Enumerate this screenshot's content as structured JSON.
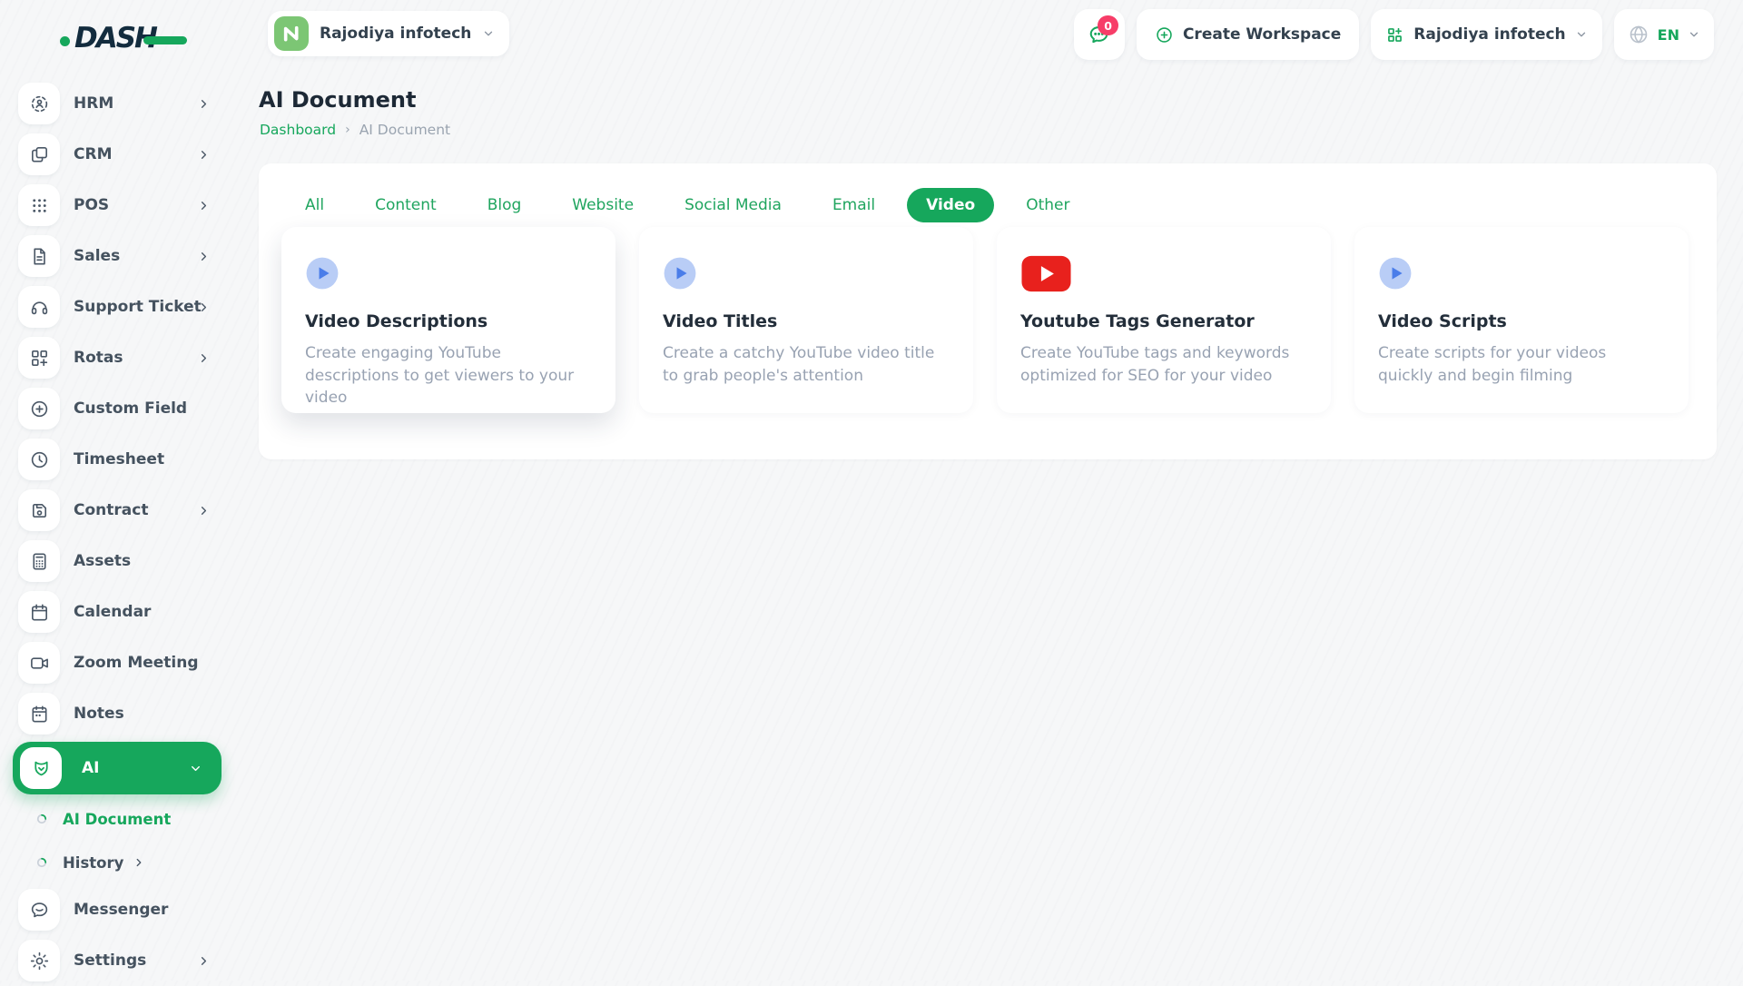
{
  "brand": {
    "logo_text": "DASH"
  },
  "header": {
    "workspace_switcher": {
      "label": "Rajodiya infotech",
      "icon": "workspace-logo-icon"
    },
    "messages_badge": "0",
    "create_workspace_label": "Create Workspace",
    "account_menu_label": "Rajodiya infotech",
    "language": "EN"
  },
  "page": {
    "title": "AI Document",
    "breadcrumb": {
      "items": [
        "Dashboard",
        "AI Document"
      ],
      "separator": "›"
    }
  },
  "sidebar": {
    "items": [
      {
        "label": "HRM",
        "icon": "hrm-icon",
        "type": "main",
        "expandable": true
      },
      {
        "label": "CRM",
        "icon": "crm-icon",
        "type": "main",
        "expandable": true
      },
      {
        "label": "POS",
        "icon": "pos-icon",
        "type": "main",
        "expandable": true
      },
      {
        "label": "Sales",
        "icon": "sales-icon",
        "type": "main",
        "expandable": true
      },
      {
        "label": "Support Ticket",
        "icon": "support-ticket-icon",
        "type": "main",
        "expandable": true
      },
      {
        "label": "Rotas",
        "icon": "rotas-icon",
        "type": "main",
        "expandable": true
      },
      {
        "label": "Custom Field",
        "icon": "custom-field-icon",
        "type": "main",
        "expandable": false
      },
      {
        "label": "Timesheet",
        "icon": "timesheet-icon",
        "type": "main",
        "expandable": false
      },
      {
        "label": "Contract",
        "icon": "contract-icon",
        "type": "main",
        "expandable": true
      },
      {
        "label": "Assets",
        "icon": "assets-icon",
        "type": "main",
        "expandable": false
      },
      {
        "label": "Calendar",
        "icon": "calendar-icon",
        "type": "main",
        "expandable": false
      },
      {
        "label": "Zoom Meeting",
        "icon": "zoom-meeting-icon",
        "type": "main",
        "expandable": false
      },
      {
        "label": "Notes",
        "icon": "notes-icon",
        "type": "main",
        "expandable": false
      },
      {
        "label": "AI",
        "icon": "ai-icon",
        "type": "parent-active",
        "expandable": true,
        "expanded": true
      },
      {
        "label": "AI Document",
        "icon": "progress-dot-icon",
        "type": "sub",
        "active": true
      },
      {
        "label": "History",
        "icon": "progress-dot-icon",
        "type": "sub",
        "expandable": true
      },
      {
        "label": "Messenger",
        "icon": "messenger-icon",
        "type": "main",
        "expandable": false
      },
      {
        "label": "Settings",
        "icon": "settings-icon",
        "type": "main",
        "expandable": true
      }
    ]
  },
  "tabs": {
    "items": [
      {
        "label": "All"
      },
      {
        "label": "Content"
      },
      {
        "label": "Blog"
      },
      {
        "label": "Website"
      },
      {
        "label": "Social Media"
      },
      {
        "label": "Email"
      },
      {
        "label": "Video",
        "active": true
      },
      {
        "label": "Other"
      }
    ]
  },
  "cards": [
    {
      "title": "Video Descriptions",
      "description": "Create engaging YouTube descriptions to get viewers to your video",
      "icon": "play-circle-icon",
      "featured": true
    },
    {
      "title": "Video Titles",
      "description": "Create a catchy YouTube video title to grab people's attention",
      "icon": "play-circle-icon",
      "featured": false
    },
    {
      "title": "Youtube Tags Generator",
      "description": "Create YouTube tags and keywords optimized for SEO for your video",
      "icon": "youtube-icon",
      "featured": false
    },
    {
      "title": "Video Scripts",
      "description": "Create scripts for your videos quickly and begin filming",
      "icon": "play-circle-icon",
      "featured": false
    }
  ],
  "colors": {
    "accent_green": "#16a75c",
    "badge_pink": "#f73d68",
    "youtube_red": "#e8211d",
    "play_blue": "#4a7de9",
    "play_blue_bg": "#b9cdf6",
    "logo_navy": "#132c3e"
  }
}
